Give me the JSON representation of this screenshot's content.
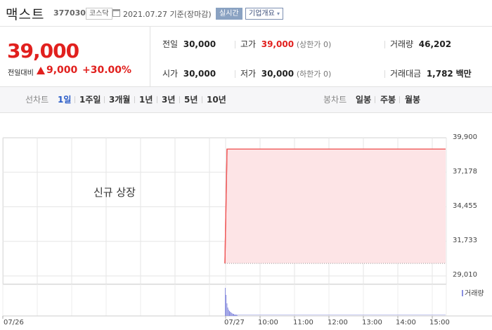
{
  "header": {
    "name": "맥스트",
    "code": "377030",
    "market": "코스닥",
    "date": "2021.07.27  기준(장마감)",
    "realtime": "실시간",
    "company_info": "기업개요",
    "dropdown_glyph": "▾"
  },
  "quote": {
    "price": "39,000",
    "change_label": "전일대비",
    "change_value": "9,000",
    "change_pct": "+30.00%",
    "rows": [
      [
        {
          "label": "전일",
          "value": "30,000"
        },
        {
          "label": "고가",
          "value": "39,000",
          "red": true,
          "sub": "(상한가 0)"
        },
        {
          "label": "거래량",
          "value": "46,202"
        }
      ],
      [
        {
          "label": "시가",
          "value": "30,000"
        },
        {
          "label": "저가",
          "value": "30,000",
          "sub": "(하한가 0)"
        },
        {
          "label": "거래대금",
          "value": "1,782",
          "unit": "백만"
        }
      ]
    ]
  },
  "tabs": {
    "line_label": "선차트",
    "line_items": [
      "1일",
      "1주일",
      "3개월",
      "1년",
      "3년",
      "5년",
      "10년"
    ],
    "selected_line": 0,
    "candle_label": "봉차트",
    "candle_items": [
      "일봉",
      "주봉",
      "월봉"
    ]
  },
  "colors": {
    "accent_red": "#e1201e",
    "price_line": "#ef5a5a",
    "area_fill": "#fde4e6",
    "volume_bar": "#8a8fe0",
    "selected_tab": "#2a5cc7"
  },
  "chart_data": {
    "type": "area",
    "annotation": "신규 상장",
    "y_ticks": [
      "39,900",
      "37,178",
      "34,455",
      "31,733",
      "29,010"
    ],
    "ylim": [
      29010,
      39900
    ],
    "x_labels": [
      "07/26",
      "07/27",
      "10:00",
      "11:00",
      "12:00",
      "13:00",
      "14:00",
      "15:00"
    ],
    "base_price": 30000,
    "series": [
      {
        "name": "",
        "x": [
          "07/27 09:00",
          "07/27 09:01",
          "07/27 15:30"
        ],
        "values": [
          30000,
          39000,
          39000
        ]
      }
    ],
    "volume_label": "거래량"
  }
}
